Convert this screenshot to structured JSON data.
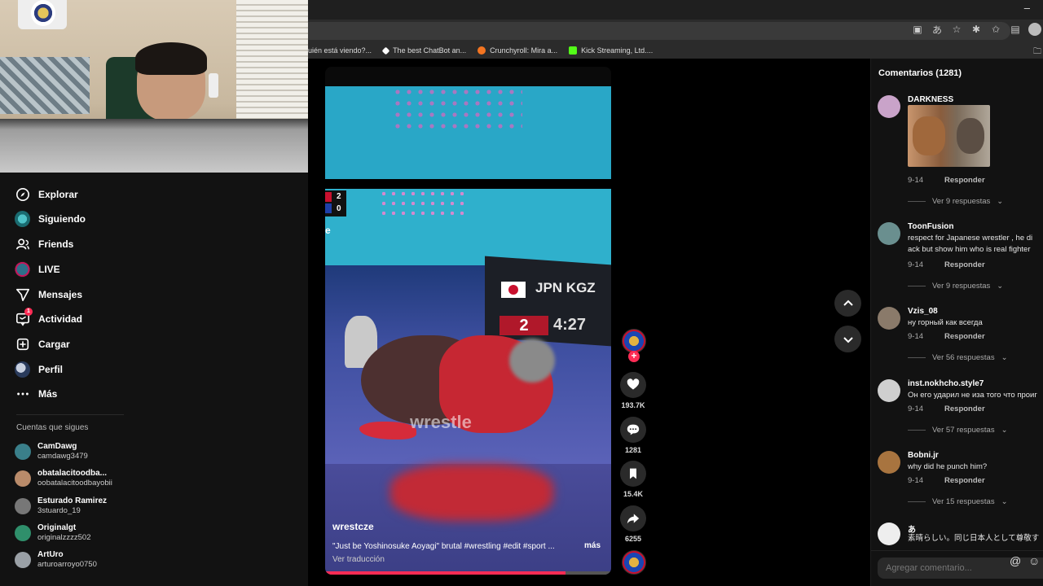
{
  "browser": {
    "window_minimize": "–",
    "bookmarks": [
      {
        "label": "uién está viendo?...",
        "color": "#888888"
      },
      {
        "label": "The best ChatBot an...",
        "color": "#ffffff"
      },
      {
        "label": "Crunchyroll: Mira a...",
        "color": "#f47521"
      },
      {
        "label": "Kick Streaming, Ltd....",
        "color": "#53fc18"
      }
    ]
  },
  "sidebar": {
    "nav": [
      {
        "label": "Explorar",
        "icon": "compass-icon"
      },
      {
        "label": "Siguiendo",
        "icon": "following-avatar-icon"
      },
      {
        "label": "Friends",
        "icon": "friends-icon"
      },
      {
        "label": "LIVE",
        "icon": "live-icon"
      },
      {
        "label": "Mensajes",
        "icon": "send-icon"
      },
      {
        "label": "Actividad",
        "icon": "activity-icon",
        "badge": "1"
      },
      {
        "label": "Cargar",
        "icon": "upload-plus-icon"
      },
      {
        "label": "Perfil",
        "icon": "profile-avatar-icon"
      },
      {
        "label": "Más",
        "icon": "more-dots-icon"
      }
    ],
    "following_header": "Cuentas que sigues",
    "following": [
      {
        "name": "CamDawg",
        "handle": "camdawg3479",
        "color": "#3a7f8a"
      },
      {
        "name": "obatalacitoodba...",
        "handle": "oobatalacitoodbayobii",
        "color": "#b98b6a"
      },
      {
        "name": "Esturado Ramirez",
        "handle": "3stuardo_19",
        "color": "#777777"
      },
      {
        "name": "Originalgt",
        "handle": "originalzzzz502",
        "color": "#2f8f6b"
      },
      {
        "name": "ArtUro",
        "handle": "arturoarroyo0750",
        "color": "#9aa0a6"
      }
    ]
  },
  "video": {
    "scoreboard_left": [
      "2",
      "0"
    ],
    "scoreboard_letter": "e",
    "board_countries": "JPN KGZ",
    "board_score": "2",
    "board_time": "4:27",
    "watermark": "wrestle",
    "author": "wrestcze",
    "description": "\"Just be Yoshinosuke Aoyagi\" brutal\u0000 #wrestling #edit #sport ...",
    "more_label": "más",
    "translate_label": "Ver traducción",
    "progress": 0.84
  },
  "actions": {
    "likes": "193.7K",
    "comments": "1281",
    "saves": "15.4K",
    "shares": "6255"
  },
  "comments_panel": {
    "title": "Comentarios (1281)",
    "reply_label": "Responder",
    "input_placeholder": "Agregar comentario...",
    "items": [
      {
        "user": "DARKNESS",
        "text": "",
        "date": "9-14",
        "replies": "Ver 9 respuestas",
        "color": "#c9a3c9"
      },
      {
        "user": "ToonFusion",
        "text": "respect for Japanese wrestler , he di\nack but show him who is real fighter",
        "date": "9-14",
        "replies": "Ver 9 respuestas",
        "color": "#6a8f8f"
      },
      {
        "user": "Vzis_08",
        "text": "ну горный как всегда",
        "date": "9-14",
        "replies": "Ver 56 respuestas",
        "color": "#8a7a6a"
      },
      {
        "user": "inst.nokhcho.style7",
        "text": "Он его ударил не иза того что проиг",
        "date": "9-14",
        "replies": "Ver 57 respuestas",
        "color": "#cfcfcf"
      },
      {
        "user": "Bobni.jr",
        "text": "why did he punch him?",
        "date": "9-14",
        "replies": "Ver 15 respuestas",
        "color": "#a8743f"
      },
      {
        "user": "あ",
        "text": "素晴らしい。同じ日本人として尊敬す",
        "color": "#eeeeee"
      }
    ]
  }
}
